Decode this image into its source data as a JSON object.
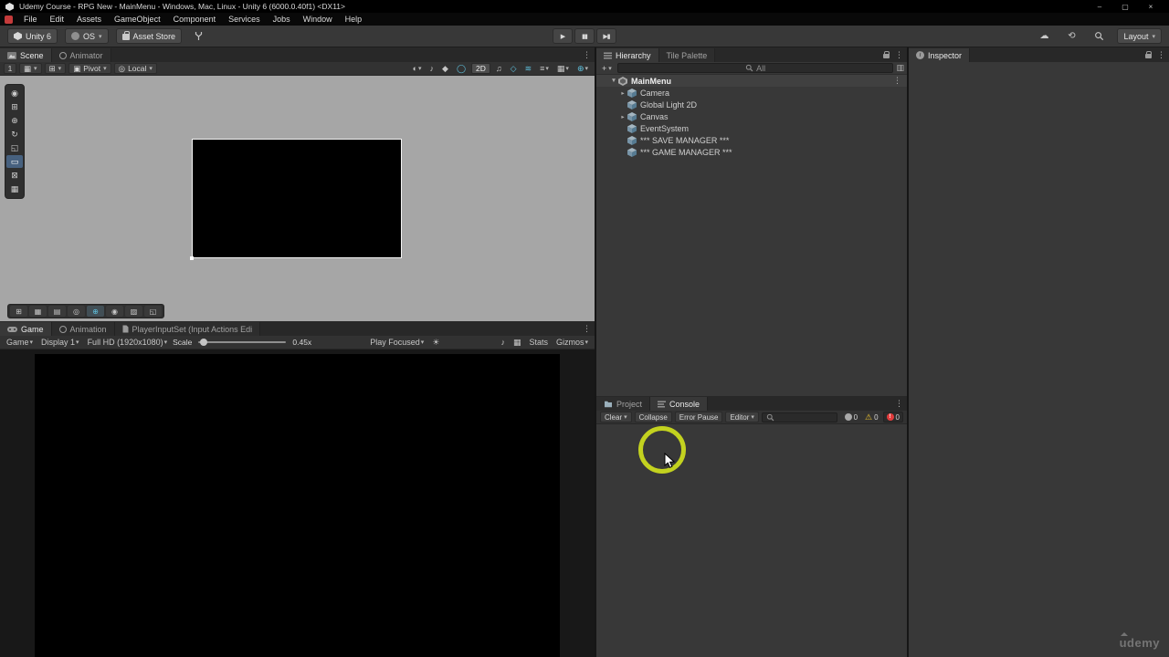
{
  "colors": {
    "highlight_ring": "#c3d21f",
    "warning": "#f0c52e",
    "error": "#e23c3c"
  },
  "window": {
    "title": "Udemy Course - RPG New - MainMenu - Windows, Mac, Linux - Unity 6 (6000.0.40f1) <DX11>"
  },
  "menu_bar": {
    "items": [
      "File",
      "Edit",
      "Assets",
      "GameObject",
      "Component",
      "Services",
      "Jobs",
      "Window",
      "Help"
    ]
  },
  "toolbar": {
    "unity_version_label": "Unity 6",
    "account_label": "OS",
    "asset_store_label": "Asset Store",
    "layout_label": "Layout"
  },
  "icons": {
    "dropdown": "▾",
    "play": "▶",
    "pause": "▮▮",
    "step": "▶▮",
    "cloud": "☁",
    "history": "⟲",
    "menu_dots": "⋮",
    "minimize": "–",
    "maximize": "▢",
    "close": "×",
    "warning": "⚠",
    "error_mark": "!",
    "plus": "+",
    "info_letter": "i",
    "layers": "▥"
  },
  "scene_panel": {
    "tabs": [
      {
        "label": "Scene"
      },
      {
        "label": "Animator"
      }
    ],
    "toolbar": {
      "grid_size": "1",
      "dropdown_a": "▦",
      "dropdown_b": "⊞",
      "pivot_icon": "▣",
      "pivot_label": "Pivot",
      "local_icon": "◎",
      "local_label": "Local",
      "mode_2d": "2D",
      "pre_icons": [
        {
          "glyph": "◐"
        },
        {
          "glyph": "♪"
        },
        {
          "glyph": "◆"
        },
        {
          "glyph": "◯"
        }
      ],
      "post_icons": [
        {
          "glyph": "♫"
        },
        {
          "glyph": "◇"
        },
        {
          "glyph": "≋"
        },
        {
          "glyph": "≡"
        },
        {
          "glyph": "▦"
        },
        {
          "glyph": "⊕"
        }
      ]
    },
    "tool_strip": [
      {
        "glyph": "◉"
      },
      {
        "glyph": "⊞"
      },
      {
        "glyph": "⊕"
      },
      {
        "glyph": "↻"
      },
      {
        "glyph": "◱"
      },
      {
        "glyph": "▭"
      },
      {
        "glyph": "⊠"
      },
      {
        "glyph": "▦"
      }
    ],
    "overlay_tools": [
      {
        "glyph": "⊞"
      },
      {
        "glyph": "▦"
      },
      {
        "glyph": "▤"
      },
      {
        "glyph": "◎"
      },
      {
        "glyph": "⊕"
      },
      {
        "glyph": "◉"
      },
      {
        "glyph": "▨"
      },
      {
        "glyph": "◱"
      }
    ]
  },
  "game_panel": {
    "tabs": [
      {
        "label": "Game"
      },
      {
        "label": "Animation"
      },
      {
        "label": "PlayerInputSet (Input Actions Edi"
      }
    ],
    "toolbar": {
      "target_label": "Game",
      "display_label": "Display 1",
      "resolution_label": "Full HD (1920x1080)",
      "scale_label": "Scale",
      "scale_value": "0.45x",
      "focus_label": "Play Focused",
      "light_icon": "☀",
      "mute_icon": "♪",
      "grid_icon": "▦",
      "stats_label": "Stats",
      "gizmos_label": "Gizmos"
    }
  },
  "hierarchy_panel": {
    "tabs": [
      {
        "label": "Hierarchy"
      },
      {
        "label": "Tile Palette"
      }
    ],
    "create_label": "+",
    "search_placeholder": "All",
    "items": [
      {
        "label": "MainMenu",
        "expander": "▼"
      },
      {
        "label": "Camera",
        "expander": "▸"
      },
      {
        "label": "Global Light 2D",
        "expander": ""
      },
      {
        "label": "Canvas",
        "expander": "▸"
      },
      {
        "label": "EventSystem",
        "expander": ""
      },
      {
        "label": "*** SAVE MANAGER ***",
        "expander": ""
      },
      {
        "label": "*** GAME MANAGER ***",
        "expander": ""
      }
    ]
  },
  "console_panel": {
    "tabs": [
      {
        "label": "Project"
      },
      {
        "label": "Console"
      }
    ],
    "toolbar": {
      "clear_label": "Clear",
      "collapse_label": "Collapse",
      "error_pause_label": "Error Pause",
      "editor_label": "Editor",
      "info_count": "0",
      "warning_count": "0",
      "error_count": "0"
    }
  },
  "inspector_panel": {
    "tab_label": "Inspector"
  },
  "watermark": {
    "brand": "udemy"
  }
}
